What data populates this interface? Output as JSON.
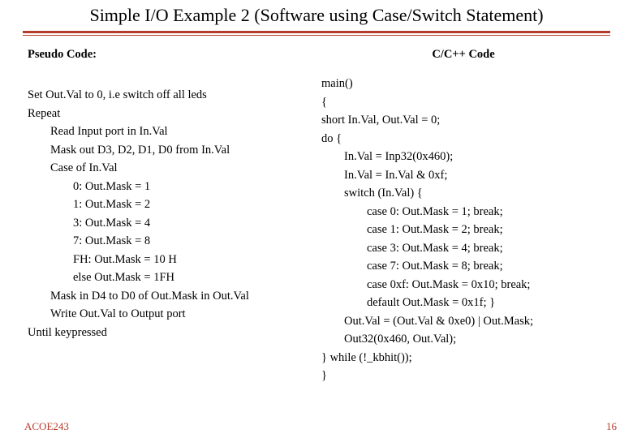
{
  "title": "Simple I/O Example 2 (Software using Case/Switch Statement)",
  "left": {
    "heading": "Pseudo Code:",
    "l1": "Set Out.Val to 0, i.e switch off all leds",
    "l2": "Repeat",
    "l3": "Read Input port in In.Val",
    "l4": "Mask out D3, D2, D1, D0 from In.Val",
    "l5": "Case of In.Val",
    "l6": "0: Out.Mask = 1",
    "l7": "1: Out.Mask = 2",
    "l8": "3: Out.Mask = 4",
    "l9": "7: Out.Mask = 8",
    "l10": "FH: Out.Mask = 10 H",
    "l11": "else Out.Mask = 1FH",
    "l12": "Mask in D4 to D0 of Out.Mask in Out.Val",
    "l13": "Write Out.Val to Output port",
    "l14": "Until keypressed"
  },
  "right": {
    "heading": "C/C++ Code",
    "r1": "main()",
    "r2": "{",
    "r3": "short In.Val, Out.Val = 0;",
    "r4": "do {",
    "r5": "In.Val = Inp32(0x460);",
    "r6": "In.Val = In.Val & 0xf;",
    "r7": "switch (In.Val) {",
    "r8": "case 0: Out.Mask = 1; break;",
    "r9": "case 1: Out.Mask = 2; break;",
    "r10": "case 3: Out.Mask = 4; break;",
    "r11": "case 7: Out.Mask = 8; break;",
    "r12": "case 0xf: Out.Mask = 0x10; break;",
    "r13": "default Out.Mask = 0x1f; }",
    "r14": "Out.Val = (Out.Val & 0xe0) | Out.Mask;",
    "r15": "Out32(0x460, Out.Val);",
    "r16": "} while (!_kbhit());",
    "r17": "}"
  },
  "footer": {
    "left": "ACOE243",
    "right": "16"
  }
}
